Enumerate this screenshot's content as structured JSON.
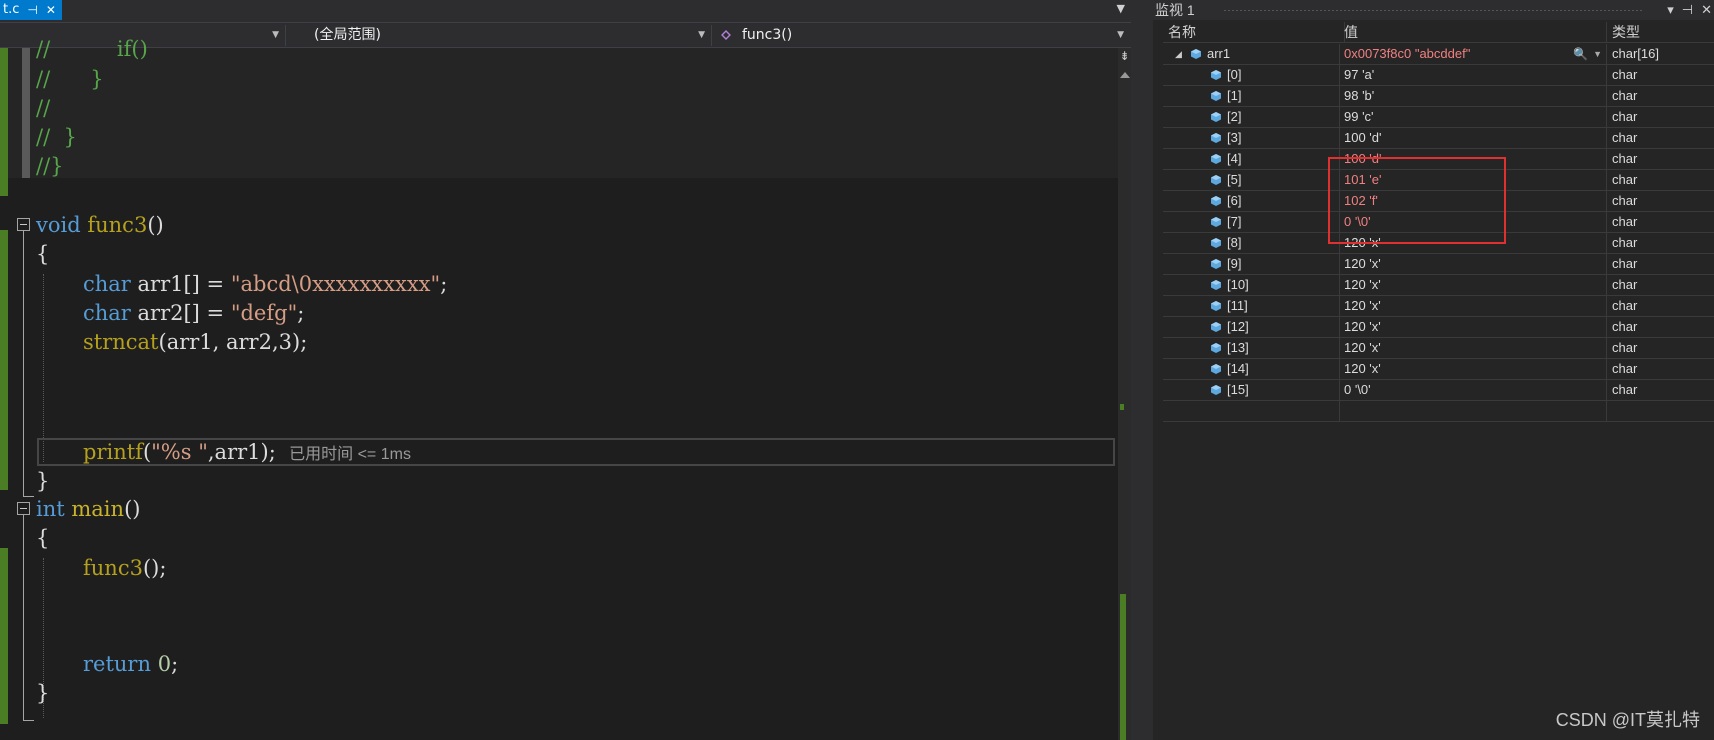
{
  "editor": {
    "tab_label": "t.c",
    "tab_pin": "⊣",
    "tab_close": "✕",
    "nav": {
      "project": "",
      "scope": "(全局范围)",
      "function": "func3()"
    },
    "code": {
      "c1": "//          if()",
      "c2": "//      }",
      "c3": "//",
      "c4": "//  }",
      "c5": "//}",
      "void": "void",
      "func3": "func3",
      "parens": "()",
      "brace_open": "{",
      "brace_close": "}",
      "char": "char",
      "arr1_decl": " arr1[] = ",
      "arr1_str": "\"abcd\\0xxxxxxxxxx\"",
      "semi": ";",
      "arr2_decl": " arr2[] = ",
      "arr2_str": "\"defg\"",
      "strncat": "strncat",
      "strncat_args": "(arr1, arr2,3);",
      "printf": "printf",
      "paren_open": "(",
      "printf_str": "\"%s \"",
      "printf_args": ",arr1);",
      "elapsed": "已用时间 <= 1ms",
      "int": "int",
      "main": "main",
      "func3_call": "func3",
      "call_rest": "();",
      "return": "return",
      "zero": "0",
      "return_semi": ";"
    }
  },
  "watch": {
    "title": "监视 1",
    "buttons": [
      "▾",
      "⊣",
      "✕"
    ],
    "columns": {
      "name": "名称",
      "value": "值",
      "type": "类型"
    },
    "root": {
      "name": "arr1",
      "value": "0x0073f8c0 \"abcddef\"",
      "type": "char[16]"
    },
    "items": [
      {
        "name": "[0]",
        "value": "97 'a'",
        "type": "char",
        "changed": false
      },
      {
        "name": "[1]",
        "value": "98 'b'",
        "type": "char",
        "changed": false
      },
      {
        "name": "[2]",
        "value": "99 'c'",
        "type": "char",
        "changed": false
      },
      {
        "name": "[3]",
        "value": "100 'd'",
        "type": "char",
        "changed": false
      },
      {
        "name": "[4]",
        "value": "100 'd'",
        "type": "char",
        "changed": true
      },
      {
        "name": "[5]",
        "value": "101 'e'",
        "type": "char",
        "changed": true
      },
      {
        "name": "[6]",
        "value": "102 'f'",
        "type": "char",
        "changed": true
      },
      {
        "name": "[7]",
        "value": "0 '\\0'",
        "type": "char",
        "changed": true
      },
      {
        "name": "[8]",
        "value": "120 'x'",
        "type": "char",
        "changed": false
      },
      {
        "name": "[9]",
        "value": "120 'x'",
        "type": "char",
        "changed": false
      },
      {
        "name": "[10]",
        "value": "120 'x'",
        "type": "char",
        "changed": false
      },
      {
        "name": "[11]",
        "value": "120 'x'",
        "type": "char",
        "changed": false
      },
      {
        "name": "[12]",
        "value": "120 'x'",
        "type": "char",
        "changed": false
      },
      {
        "name": "[13]",
        "value": "120 'x'",
        "type": "char",
        "changed": false
      },
      {
        "name": "[14]",
        "value": "120 'x'",
        "type": "char",
        "changed": false
      },
      {
        "name": "[15]",
        "value": "0 '\\0'",
        "type": "char",
        "changed": false
      }
    ],
    "colors": {
      "changed": "#f08080",
      "highlight_box": "#e03030",
      "accent": "#007acc"
    }
  },
  "watermark": "CSDN @IT莫扎特"
}
